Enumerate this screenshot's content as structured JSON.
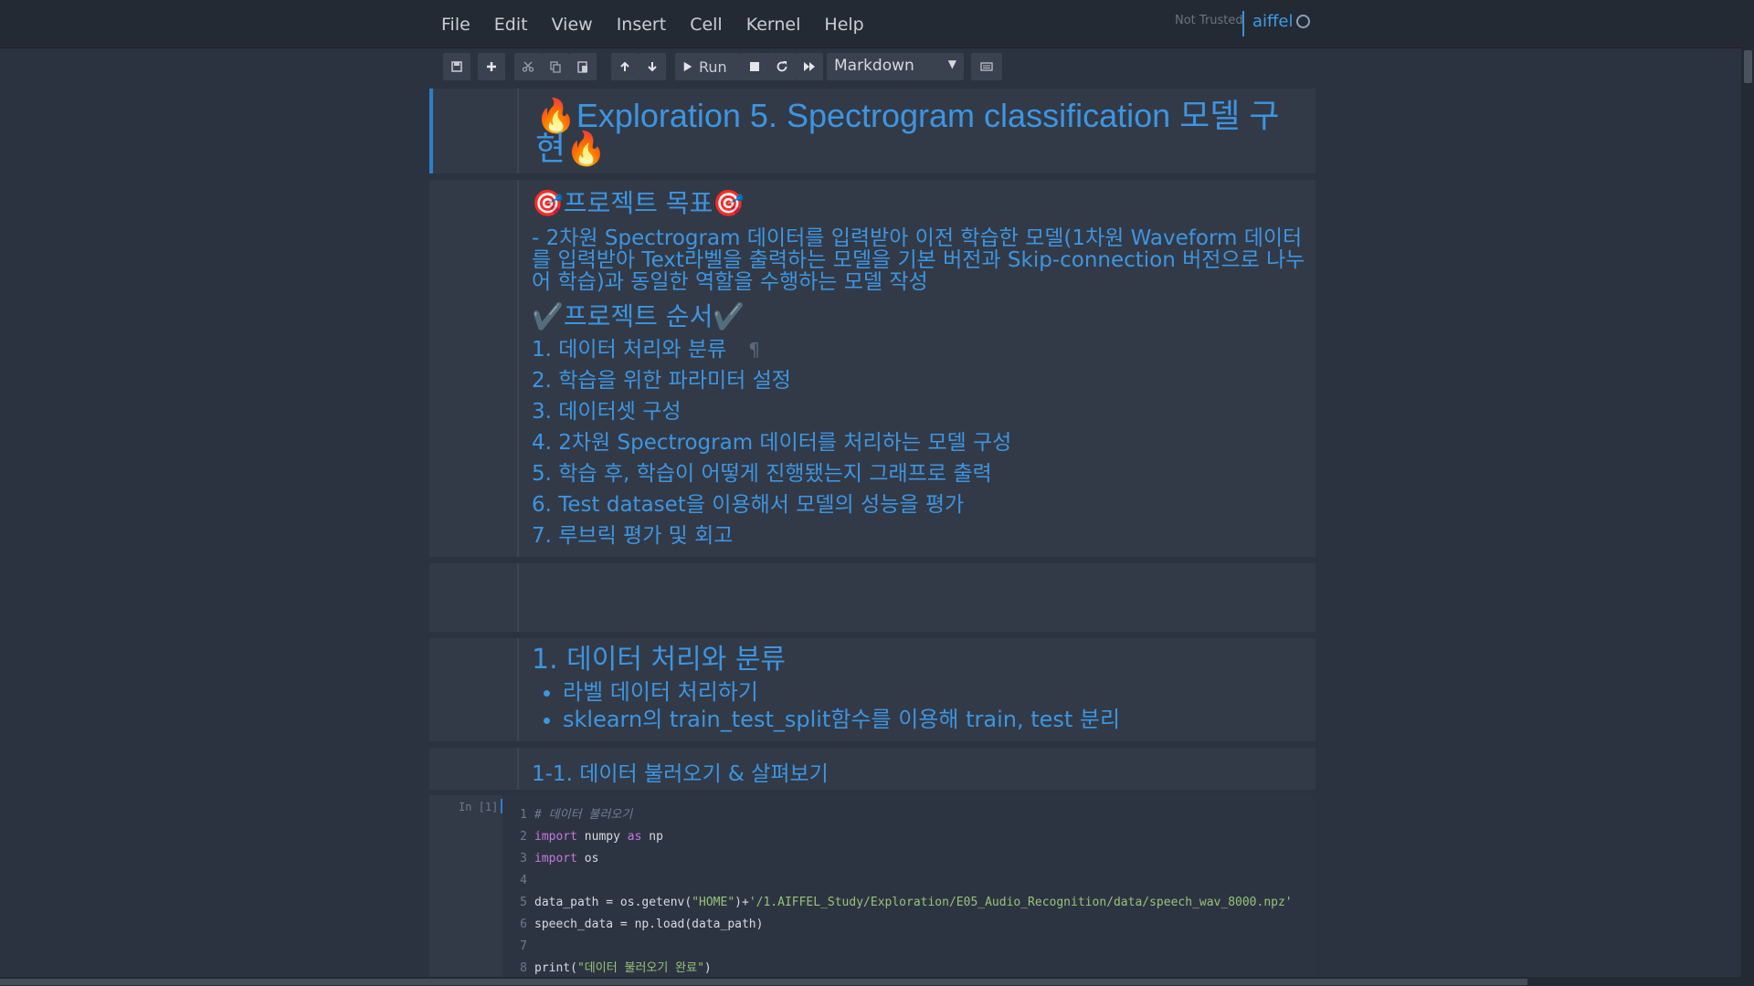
{
  "menu": [
    "File",
    "Edit",
    "View",
    "Insert",
    "Cell",
    "Kernel",
    "Help"
  ],
  "header": {
    "trusted": "Not Trusted",
    "kernel_name": "aiffel"
  },
  "toolbar": {
    "run_label": "Run",
    "cell_type": "Markdown"
  },
  "cells": {
    "title": "🔥Exploration 5. Spectrogram classification 모델 구현🔥",
    "goal_heading": "🎯프로젝트 목표🎯",
    "goal_text": "- 2차원 Spectrogram 데이터를 입력받아 이전 학습한 모델(1차원 Waveform 데이터를 입력받아 Text라벨을 출력하는 모델을 기본 버전과 Skip-connection 버전으로 나누어 학습)과 동일한 역할을 수행하는 모델 작성",
    "order_heading": "✔️프로젝트 순서✔️",
    "order_items": [
      "1. 데이터 처리와 분류",
      "2. 학습을 위한 파라미터 설정",
      "3. 데이터셋 구성",
      "4. 2차원 Spectrogram 데이터를 처리하는 모델 구성",
      "5. 학습 후, 학습이 어떻게 진행됐는지 그래프로 출력",
      "6. Test dataset을 이용해서 모델의 성능을 평가",
      "7. 루브릭 평가 및 회고"
    ],
    "pilcrow": "¶",
    "section1_heading": "1. 데이터 처리와 분류",
    "section1_bullets": [
      "라벨 데이터 처리하기",
      "sklearn의 train_test_split함수를 이용해 train, test 분리"
    ],
    "subsection_heading": "1-1. 데이터 불러오기 & 살펴보기"
  },
  "code_cell": {
    "prompt": "In [1]:",
    "lines": [
      "1",
      "2",
      "3",
      "4",
      "5",
      "6",
      "7",
      "8"
    ],
    "comment": "# 데이터 불러오기",
    "import": "import",
    "as": "as",
    "line2_mod": " numpy ",
    "line2_alias": " np",
    "line3_mod": " os",
    "line5_a": "data_path = os.getenv(",
    "line5_home": "\"HOME\"",
    "line5_b": ")+",
    "line5_path": "'/1.AIFFEL_Study/Exploration/E05_Audio_Recognition/data/speech_wav_8000.npz'",
    "line6": "speech_data = np.load(data_path)",
    "line8_a": "print(",
    "line8_str": "\"데이터 불러오기 완료\"",
    "line8_b": ")"
  },
  "colors": {
    "accent": "#3e95e0",
    "background": "#2b3340",
    "cell": "#323a47"
  }
}
